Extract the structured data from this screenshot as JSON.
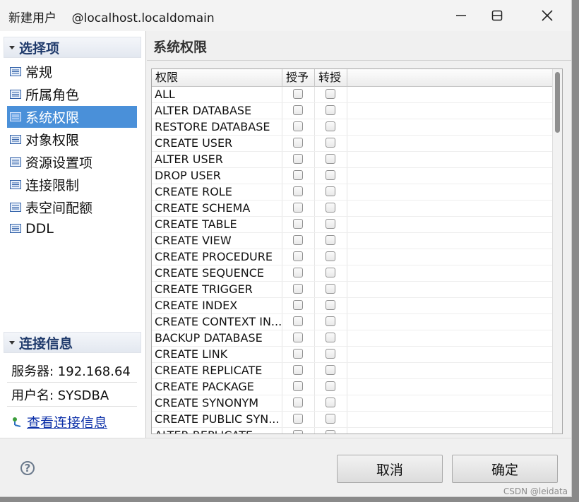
{
  "window": {
    "title": "新建用户    @localhost.localdomain"
  },
  "left": {
    "select_header": "选择项",
    "nav_items": [
      {
        "label": "常规",
        "selected": false
      },
      {
        "label": "所属角色",
        "selected": false
      },
      {
        "label": "系统权限",
        "selected": true
      },
      {
        "label": "对象权限",
        "selected": false
      },
      {
        "label": "资源设置项",
        "selected": false
      },
      {
        "label": "连接限制",
        "selected": false
      },
      {
        "label": "表空间配额",
        "selected": false
      },
      {
        "label": "DDL",
        "selected": false
      }
    ],
    "conn_header": "连接信息",
    "server_text": "服务器: 192.168.64",
    "user_text": "用户名: SYSDBA",
    "view_link": "查看连接信息"
  },
  "right": {
    "title": "系统权限",
    "columns": [
      "权限",
      "授予",
      "转授"
    ],
    "rows": [
      "ALL",
      "ALTER DATABASE",
      "RESTORE DATABASE",
      "CREATE USER",
      "ALTER USER",
      "DROP USER",
      "CREATE ROLE",
      "CREATE SCHEMA",
      "CREATE TABLE",
      "CREATE VIEW",
      "CREATE PROCEDURE",
      "CREATE SEQUENCE",
      "CREATE TRIGGER",
      "CREATE INDEX",
      "CREATE CONTEXT IN...",
      "BACKUP DATABASE",
      "CREATE LINK",
      "CREATE REPLICATE",
      "CREATE PACKAGE",
      "CREATE SYNONYM",
      "CREATE PUBLIC SYN...",
      "ALTER REPLICATE"
    ]
  },
  "buttons": {
    "help": "?",
    "cancel": "取消",
    "ok": "确定"
  },
  "watermark": "CSDN @leidata",
  "colors": {
    "selected_bg": "#4a90d9",
    "header_text": "#1f3a6b",
    "link": "#0b2fa8"
  }
}
